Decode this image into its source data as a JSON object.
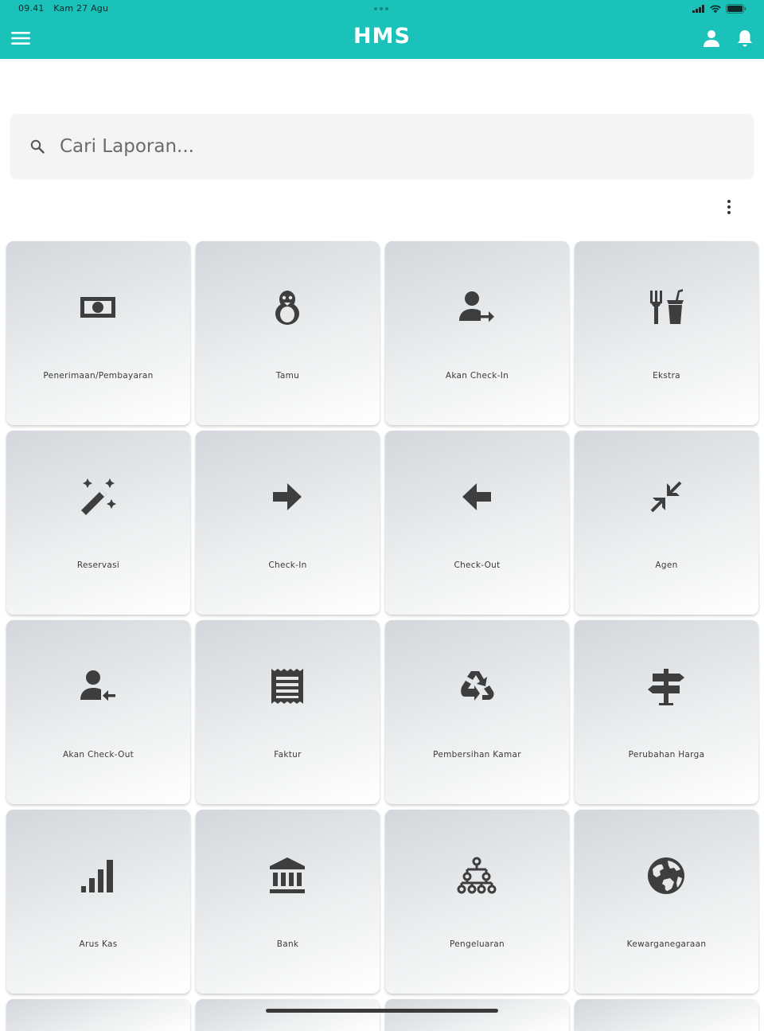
{
  "status_bar": {
    "time": "09.41",
    "date": "Kam 27 Agu"
  },
  "app_bar": {
    "brand": "HMS"
  },
  "search": {
    "placeholder": "Cari Laporan..."
  },
  "colors": {
    "primary": "#1bc2b9",
    "icon": "#3e3e3e",
    "card_gradient_start": "#d3d7db",
    "card_gradient_end": "#ffffff"
  },
  "tiles": [
    {
      "label": "Penerimaan/Pembayaran",
      "icon": "money-icon"
    },
    {
      "label": "Tamu",
      "icon": "penguin-icon"
    },
    {
      "label": "Akan Check-In",
      "icon": "person-arrow-right-icon"
    },
    {
      "label": "Ekstra",
      "icon": "restaurant-icon"
    },
    {
      "label": "Reservasi",
      "icon": "magic-wand-icon"
    },
    {
      "label": "Check-In",
      "icon": "arrow-right-icon"
    },
    {
      "label": "Check-Out",
      "icon": "arrow-left-icon"
    },
    {
      "label": "Agen",
      "icon": "compress-arrows-icon"
    },
    {
      "label": "Akan Check-Out",
      "icon": "person-arrow-left-icon"
    },
    {
      "label": "Faktur",
      "icon": "receipt-icon"
    },
    {
      "label": "Pembersihan Kamar",
      "icon": "recycle-icon"
    },
    {
      "label": "Perubahan Harga",
      "icon": "signpost-icon"
    },
    {
      "label": "Arus Kas",
      "icon": "signal-bars-icon"
    },
    {
      "label": "Bank",
      "icon": "bank-icon"
    },
    {
      "label": "Pengeluaran",
      "icon": "hierarchy-icon"
    },
    {
      "label": "Kewarganegaraan",
      "icon": "globe-icon"
    }
  ]
}
